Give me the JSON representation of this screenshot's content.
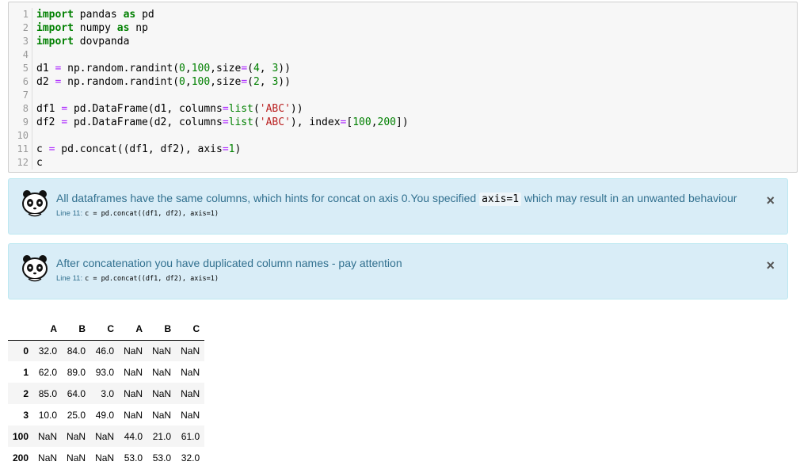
{
  "code_cell": {
    "lines": [
      {
        "n": "1",
        "tokens": [
          {
            "t": "import",
            "c": "kw"
          },
          {
            "t": " pandas ",
            "c": "plain"
          },
          {
            "t": "as",
            "c": "kw"
          },
          {
            "t": " pd",
            "c": "plain"
          }
        ]
      },
      {
        "n": "2",
        "tokens": [
          {
            "t": "import",
            "c": "kw"
          },
          {
            "t": " numpy ",
            "c": "plain"
          },
          {
            "t": "as",
            "c": "kw"
          },
          {
            "t": " np",
            "c": "plain"
          }
        ]
      },
      {
        "n": "3",
        "tokens": [
          {
            "t": "import",
            "c": "kw"
          },
          {
            "t": " dovpanda",
            "c": "plain"
          }
        ]
      },
      {
        "n": "4",
        "tokens": []
      },
      {
        "n": "5",
        "tokens": [
          {
            "t": "d1 ",
            "c": "plain"
          },
          {
            "t": "=",
            "c": "op"
          },
          {
            "t": " np.random.randint(",
            "c": "plain"
          },
          {
            "t": "0",
            "c": "num"
          },
          {
            "t": ",",
            "c": "plain"
          },
          {
            "t": "100",
            "c": "num"
          },
          {
            "t": ",size",
            "c": "plain"
          },
          {
            "t": "=",
            "c": "op"
          },
          {
            "t": "(",
            "c": "plain"
          },
          {
            "t": "4",
            "c": "num"
          },
          {
            "t": ", ",
            "c": "plain"
          },
          {
            "t": "3",
            "c": "num"
          },
          {
            "t": "))",
            "c": "plain"
          }
        ]
      },
      {
        "n": "6",
        "tokens": [
          {
            "t": "d2 ",
            "c": "plain"
          },
          {
            "t": "=",
            "c": "op"
          },
          {
            "t": " np.random.randint(",
            "c": "plain"
          },
          {
            "t": "0",
            "c": "num"
          },
          {
            "t": ",",
            "c": "plain"
          },
          {
            "t": "100",
            "c": "num"
          },
          {
            "t": ",size",
            "c": "plain"
          },
          {
            "t": "=",
            "c": "op"
          },
          {
            "t": "(",
            "c": "plain"
          },
          {
            "t": "2",
            "c": "num"
          },
          {
            "t": ", ",
            "c": "plain"
          },
          {
            "t": "3",
            "c": "num"
          },
          {
            "t": "))",
            "c": "plain"
          }
        ]
      },
      {
        "n": "7",
        "tokens": []
      },
      {
        "n": "8",
        "tokens": [
          {
            "t": "df1 ",
            "c": "plain"
          },
          {
            "t": "=",
            "c": "op"
          },
          {
            "t": " pd.DataFrame(d1, columns",
            "c": "plain"
          },
          {
            "t": "=",
            "c": "op"
          },
          {
            "t": "list",
            "c": "bi"
          },
          {
            "t": "(",
            "c": "plain"
          },
          {
            "t": "'ABC'",
            "c": "str"
          },
          {
            "t": "))",
            "c": "plain"
          }
        ]
      },
      {
        "n": "9",
        "tokens": [
          {
            "t": "df2 ",
            "c": "plain"
          },
          {
            "t": "=",
            "c": "op"
          },
          {
            "t": " pd.DataFrame(d2, columns",
            "c": "plain"
          },
          {
            "t": "=",
            "c": "op"
          },
          {
            "t": "list",
            "c": "bi"
          },
          {
            "t": "(",
            "c": "plain"
          },
          {
            "t": "'ABC'",
            "c": "str"
          },
          {
            "t": "), index",
            "c": "plain"
          },
          {
            "t": "=",
            "c": "op"
          },
          {
            "t": "[",
            "c": "plain"
          },
          {
            "t": "100",
            "c": "num"
          },
          {
            "t": ",",
            "c": "plain"
          },
          {
            "t": "200",
            "c": "num"
          },
          {
            "t": "])",
            "c": "plain"
          }
        ]
      },
      {
        "n": "10",
        "tokens": []
      },
      {
        "n": "11",
        "tokens": [
          {
            "t": "c ",
            "c": "plain"
          },
          {
            "t": "=",
            "c": "op"
          },
          {
            "t": " pd.concat((df1, df2), axis",
            "c": "plain"
          },
          {
            "t": "=",
            "c": "op"
          },
          {
            "t": "1",
            "c": "num"
          },
          {
            "t": ")",
            "c": "plain"
          }
        ]
      },
      {
        "n": "12",
        "tokens": [
          {
            "t": "c",
            "c": "plain"
          }
        ]
      }
    ]
  },
  "alerts": [
    {
      "message_before": "All dataframes have the same columns, which hints for concat on axis 0.You specified ",
      "message_code": "axis=1",
      "message_after": " which may result in an unwanted behaviour",
      "line_label": "Line 11:",
      "line_code": "c = pd.concat((df1, df2), axis=1)",
      "close_label": "×"
    },
    {
      "message_before": "After concatenation you have duplicated column names - pay attention",
      "message_code": "",
      "message_after": "",
      "line_label": "Line 11:",
      "line_code": "c = pd.concat((df1, df2), axis=1)",
      "close_label": "×"
    }
  ],
  "dataframe": {
    "columns": [
      "A",
      "B",
      "C",
      "A",
      "B",
      "C"
    ],
    "rows": [
      {
        "index": "0",
        "values": [
          "32.0",
          "84.0",
          "46.0",
          "NaN",
          "NaN",
          "NaN"
        ]
      },
      {
        "index": "1",
        "values": [
          "62.0",
          "89.0",
          "93.0",
          "NaN",
          "NaN",
          "NaN"
        ]
      },
      {
        "index": "2",
        "values": [
          "85.0",
          "64.0",
          "3.0",
          "NaN",
          "NaN",
          "NaN"
        ]
      },
      {
        "index": "3",
        "values": [
          "10.0",
          "25.0",
          "49.0",
          "NaN",
          "NaN",
          "NaN"
        ]
      },
      {
        "index": "100",
        "values": [
          "NaN",
          "NaN",
          "NaN",
          "44.0",
          "21.0",
          "61.0"
        ]
      },
      {
        "index": "200",
        "values": [
          "NaN",
          "NaN",
          "NaN",
          "53.0",
          "53.0",
          "32.0"
        ]
      }
    ]
  },
  "colors": {
    "alert_bg": "#d9edf7",
    "alert_border": "#bce8f1",
    "alert_text": "#31708f",
    "keyword": "#008000",
    "operator": "#aa22ff",
    "string": "#ba2121"
  },
  "icons": {
    "alert_icon": "panda-icon",
    "close_icon": "close-icon"
  }
}
